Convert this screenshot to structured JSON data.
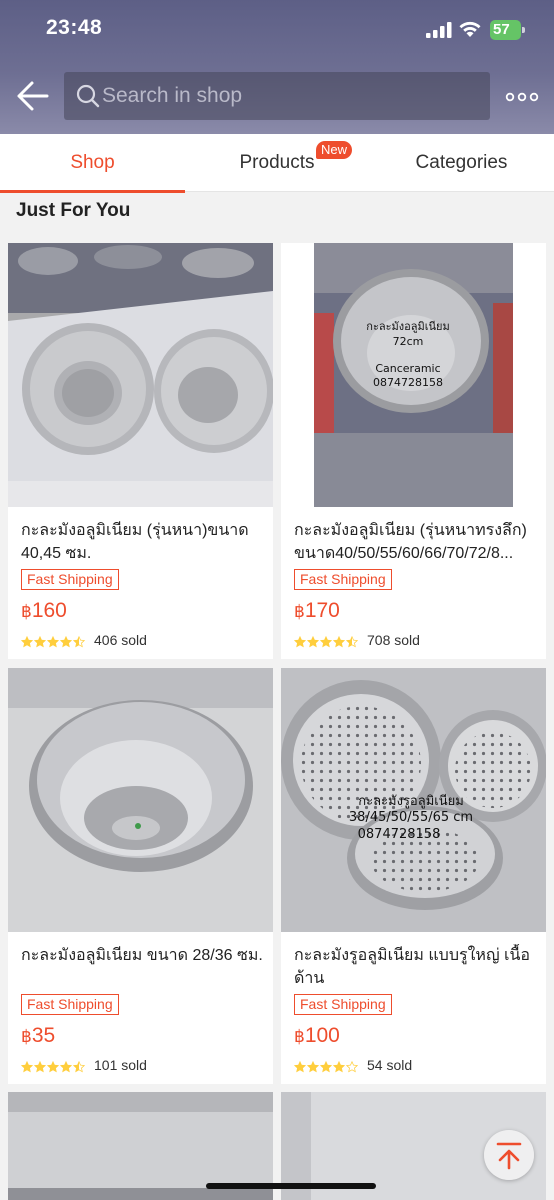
{
  "status_bar": {
    "time": "23:48",
    "battery": "57"
  },
  "search": {
    "placeholder": "Search in shop"
  },
  "tabs": [
    {
      "label": "Shop",
      "active": true
    },
    {
      "label": "Products",
      "badge": "New"
    },
    {
      "label": "Categories"
    }
  ],
  "section": {
    "title": "Just For You"
  },
  "products": [
    {
      "name": "กะละมังอลูมิเนียม (รุ่นหนา)ขนาด 40,45 ซม.",
      "badge": "Fast Shipping",
      "currency": "฿",
      "price": "160",
      "rating": 4.5,
      "sold": "406 sold"
    },
    {
      "name": "กะละมังอลูมิเนียม (รุ่นหนาทรงลึก) ขนาด40/50/55/60/66/70/72/8...",
      "badge": "Fast Shipping",
      "currency": "฿",
      "price": "170",
      "rating": 4.5,
      "sold": "708 sold",
      "image_text": {
        "line1": "กะละมังอลูมิเนียม",
        "line2": "72cm",
        "line3": "Canceramic",
        "line4": "0874728158"
      }
    },
    {
      "name": "กะละมังอลูมิเนียม ขนาด 28/36 ซม.",
      "badge": "Fast Shipping",
      "currency": "฿",
      "price": "35",
      "rating": 4.5,
      "sold": "101 sold"
    },
    {
      "name": "กะละมังรูอลูมิเนียม แบบรูใหญ่ เนื้อด้าน",
      "badge": "Fast Shipping",
      "currency": "฿",
      "price": "100",
      "rating": 4,
      "sold": "54 sold",
      "image_text": {
        "line1": "กะละมังรูอลูมิเนียม",
        "line2": "38/45/50/55/65 cm",
        "line3": "0874728158"
      }
    }
  ],
  "colors": {
    "accent": "#ee4d2d",
    "star": "#ffce3d",
    "header": "#6e6f93"
  }
}
